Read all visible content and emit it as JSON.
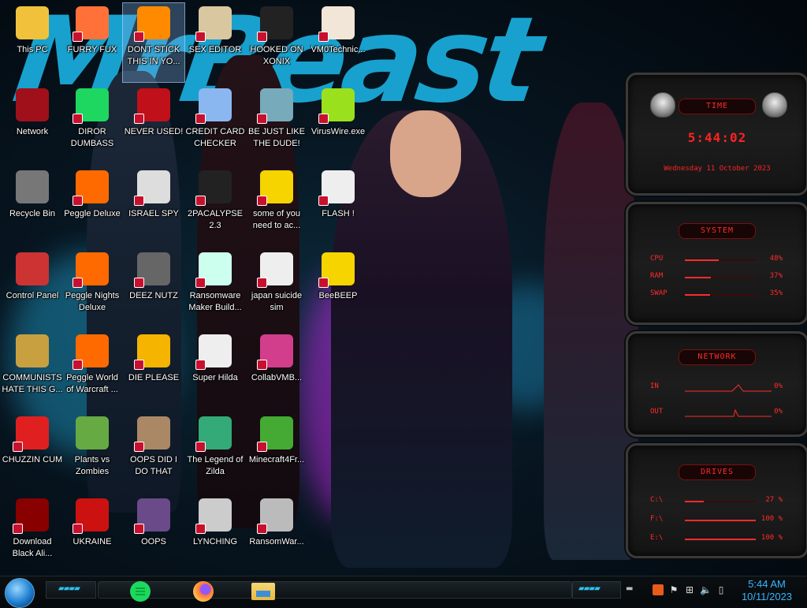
{
  "desktop": {
    "icons": [
      {
        "label": "This PC",
        "icon": "this-pc-icon"
      },
      {
        "label": "FURRY FUX",
        "icon": "firefox-icon"
      },
      {
        "label": "DONT STICK THIS IN YO...",
        "icon": "vlc-cone-icon"
      },
      {
        "label": "SEX EDITOR",
        "icon": "xd-editor-icon"
      },
      {
        "label": "HOOKED ON XONIX",
        "icon": "xonix-game-icon"
      },
      {
        "label": "VM0Technic...",
        "icon": "doctor-icon"
      },
      {
        "label": "Network",
        "icon": "network-orb-icon"
      },
      {
        "label": "DIROR DUMBASS",
        "icon": "chat-bubble-icon"
      },
      {
        "label": "NEVER USED!",
        "icon": "devcpp-icon"
      },
      {
        "label": "CREDIT CARD CHECKER",
        "icon": "credit-card-icon"
      },
      {
        "label": "BE JUST LIKE THE DUDE!",
        "icon": "santa-icon"
      },
      {
        "label": "VirusWire.exe",
        "icon": "lime-icon"
      },
      {
        "label": "Recycle Bin",
        "icon": "recycle-bin-icon"
      },
      {
        "label": "Peggle Deluxe",
        "icon": "peggle-icon"
      },
      {
        "label": "ISRAEL SPY",
        "icon": "spy-folder-icon"
      },
      {
        "label": "2PACALYPSE 2.3",
        "icon": "terminal-icon"
      },
      {
        "label": "some of you need to ac...",
        "icon": "beaver-icon"
      },
      {
        "label": "FLASH !",
        "icon": "flash-document-icon"
      },
      {
        "label": "Control Panel",
        "icon": "control-panel-icon"
      },
      {
        "label": "Peggle Nights Deluxe",
        "icon": "peggle-nights-icon"
      },
      {
        "label": "DEEZ NUTZ",
        "icon": "stacked-windows-icon"
      },
      {
        "label": "Ransomware Maker Build...",
        "icon": "ransomware-window-icon"
      },
      {
        "label": "japan suicide sim",
        "icon": "japan-sim-icon"
      },
      {
        "label": "BeeBEEP",
        "icon": "bee-icon"
      },
      {
        "label": "COMMUNISTS HATE THIS G...",
        "icon": "money-bag-icon"
      },
      {
        "label": "Peggle World of Warcraft ...",
        "icon": "peggle-wow-icon"
      },
      {
        "label": "DIE PLEASE",
        "icon": "de-icon"
      },
      {
        "label": "Super Hilda",
        "icon": "pixel-hilda-icon"
      },
      {
        "label": "CollabVMB...",
        "icon": "collabvm-icon"
      },
      {
        "label": "CHUZZIN CUM",
        "icon": "chuzzle-icon"
      },
      {
        "label": "Plants vs Zombies",
        "icon": "pvz-icon"
      },
      {
        "label": "OOPS DID I DO THAT",
        "icon": "portrait-icon"
      },
      {
        "label": "The Legend of Zilda",
        "icon": "zelda-icon"
      },
      {
        "label": "Minecraft4Fr...",
        "icon": "minecraft-icon"
      },
      {
        "label": "Download Black Ali...",
        "icon": "alienware-orb-icon"
      },
      {
        "label": "UKRAINE",
        "icon": "radiation-icon"
      },
      {
        "label": "OOPS",
        "icon": "oops-book-icon"
      },
      {
        "label": "LYNCHING",
        "icon": "lynching-icon"
      },
      {
        "label": "RansomWar...",
        "icon": "skull-icon"
      }
    ]
  },
  "wallpaper": {
    "text": "MrBeast"
  },
  "widgets": {
    "time": {
      "title": "TIME",
      "clock": "5:44:02",
      "date": "Wednesday 11 October 2023"
    },
    "system": {
      "title": "SYSTEM",
      "rows": [
        {
          "label": "CPU",
          "value": "48%",
          "level": 0.48
        },
        {
          "label": "RAM",
          "value": "37%",
          "level": 0.37
        },
        {
          "label": "SWAP",
          "value": "35%",
          "level": 0.35
        }
      ]
    },
    "network": {
      "title": "NETWORK",
      "rows": [
        {
          "label": "IN",
          "value": "0%"
        },
        {
          "label": "OUT",
          "value": "0%"
        }
      ]
    },
    "drives": {
      "title": "DRIVES",
      "rows": [
        {
          "label": "C:\\",
          "value": "27 %",
          "level": 0.27
        },
        {
          "label": "F:\\",
          "value": "100 %",
          "level": 1.0
        },
        {
          "label": "E:\\",
          "value": "100 %",
          "level": 1.0
        }
      ]
    }
  },
  "taskbar": {
    "apps": [
      "chat-app-icon",
      "firefox-icon",
      "file-explorer-icon"
    ],
    "clock": {
      "time": "5:44 AM",
      "date": "10/11/2023"
    },
    "accent": "#38b6ff"
  }
}
